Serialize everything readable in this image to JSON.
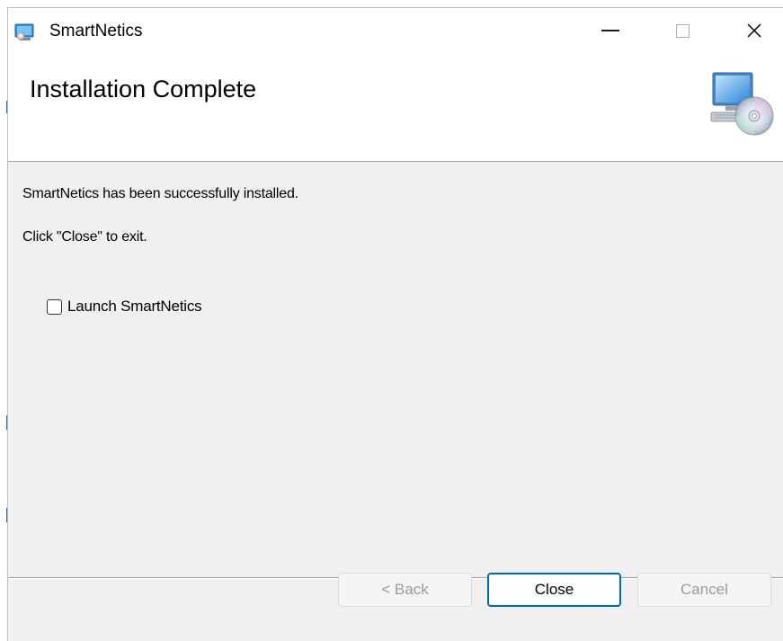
{
  "window": {
    "title": "SmartNetics",
    "minimize_glyph": "",
    "maximize_glyph": "",
    "close_glyph": "✕"
  },
  "banner": {
    "title": "Installation Complete",
    "icon": "computer-cd-icon"
  },
  "body": {
    "line1": "SmartNetics has been successfully installed.",
    "line2": "Click \"Close\" to exit.",
    "launch_checkbox": {
      "label": "Launch SmartNetics",
      "checked": false
    }
  },
  "buttons": {
    "back": "< Back",
    "close": "Close",
    "cancel": "Cancel"
  },
  "colors": {
    "accent": "#0067c0",
    "window_bg": "#f0f0f0",
    "disabled_text": "#9a9a9a"
  }
}
